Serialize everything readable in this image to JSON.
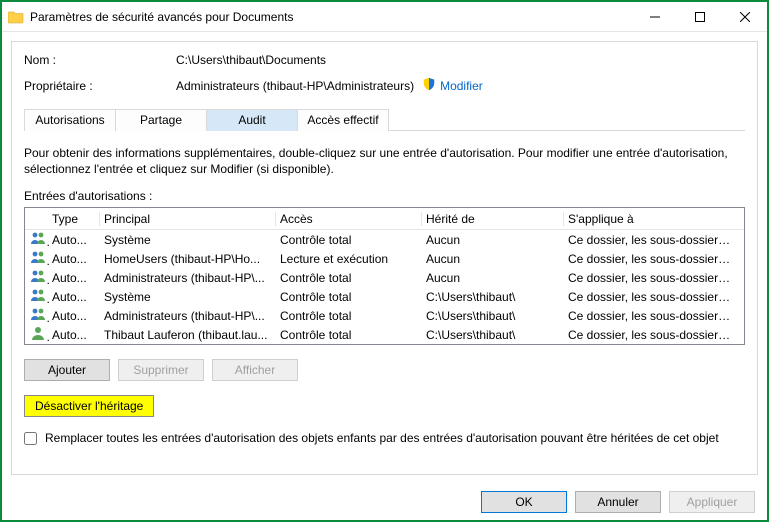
{
  "title": "Paramètres de sécurité avancés pour Documents",
  "meta": {
    "name_label": "Nom :",
    "name_value": "C:\\Users\\thibaut\\Documents",
    "owner_label": "Propriétaire :",
    "owner_value": "Administrateurs (thibaut-HP\\Administrateurs)",
    "modify_link": "Modifier"
  },
  "tabs": {
    "permissions": "Autorisations",
    "sharing": "Partage",
    "audit": "Audit",
    "effective": "Accès effectif"
  },
  "description": "Pour obtenir des informations supplémentaires, double-cliquez sur une entrée d'autorisation. Pour modifier une entrée d'autorisation, sélectionnez l'entrée et cliquez sur Modifier (si disponible).",
  "entries_label": "Entrées d'autorisations :",
  "columns": {
    "type": "Type",
    "principal": "Principal",
    "access": "Accès",
    "inherited": "Hérité de",
    "applies": "S'applique à"
  },
  "rows": [
    {
      "icon": "group",
      "type": "Auto...",
      "principal": "Système",
      "access": "Contrôle total",
      "inherited": "Aucun",
      "applies": "Ce dossier, les sous-dossiers et..."
    },
    {
      "icon": "group",
      "type": "Auto...",
      "principal": "HomeUsers (thibaut-HP\\Ho...",
      "access": "Lecture et exécution",
      "inherited": "Aucun",
      "applies": "Ce dossier, les sous-dossiers et..."
    },
    {
      "icon": "group",
      "type": "Auto...",
      "principal": "Administrateurs (thibaut-HP\\...",
      "access": "Contrôle total",
      "inherited": "Aucun",
      "applies": "Ce dossier, les sous-dossiers et..."
    },
    {
      "icon": "group",
      "type": "Auto...",
      "principal": "Système",
      "access": "Contrôle total",
      "inherited": "C:\\Users\\thibaut\\",
      "applies": "Ce dossier, les sous-dossiers et..."
    },
    {
      "icon": "group",
      "type": "Auto...",
      "principal": "Administrateurs (thibaut-HP\\...",
      "access": "Contrôle total",
      "inherited": "C:\\Users\\thibaut\\",
      "applies": "Ce dossier, les sous-dossiers et..."
    },
    {
      "icon": "user",
      "type": "Auto...",
      "principal": "Thibaut Lauferon (thibaut.lau...",
      "access": "Contrôle total",
      "inherited": "C:\\Users\\thibaut\\",
      "applies": "Ce dossier, les sous-dossiers et..."
    }
  ],
  "buttons": {
    "add": "Ajouter",
    "remove": "Supprimer",
    "view": "Afficher",
    "disable_inherit": "Désactiver l'héritage"
  },
  "replace_checkbox_label": "Remplacer toutes les entrées d'autorisation des objets enfants par des entrées d'autorisation pouvant être héritées de cet objet",
  "footer": {
    "ok": "OK",
    "cancel": "Annuler",
    "apply": "Appliquer"
  }
}
